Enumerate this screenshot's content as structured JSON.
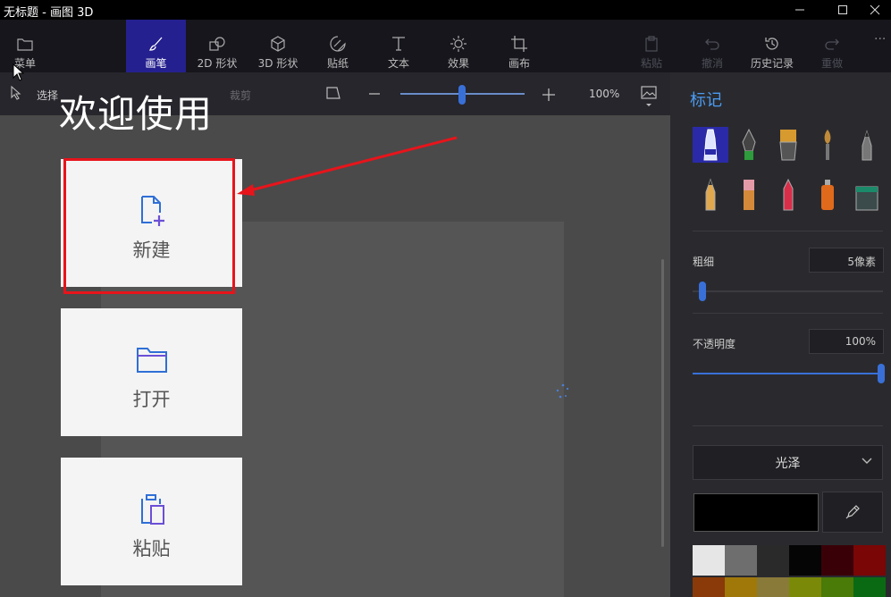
{
  "window": {
    "title": "无标题 - 画图 3D"
  },
  "toolbar": {
    "menu": "菜单",
    "items": [
      {
        "key": "brushes",
        "label": "画笔",
        "icon": "brush-icon",
        "active": true
      },
      {
        "key": "shapes2d",
        "label": "2D 形状",
        "icon": "shapes-2d-icon"
      },
      {
        "key": "shapes3d",
        "label": "3D 形状",
        "icon": "cube-icon"
      },
      {
        "key": "stickers",
        "label": "贴纸",
        "icon": "sticker-icon"
      },
      {
        "key": "text",
        "label": "文本",
        "icon": "text-icon"
      },
      {
        "key": "effects",
        "label": "效果",
        "icon": "sun-icon"
      },
      {
        "key": "canvas",
        "label": "画布",
        "icon": "crop-icon"
      }
    ],
    "right_items": [
      {
        "key": "paste",
        "label": "粘贴",
        "icon": "paste-icon",
        "disabled": true
      },
      {
        "key": "undo",
        "label": "撤消",
        "icon": "undo-icon",
        "disabled": true
      },
      {
        "key": "history",
        "label": "历史记录",
        "icon": "history-icon"
      },
      {
        "key": "redo",
        "label": "重做",
        "icon": "redo-icon",
        "disabled": true
      }
    ]
  },
  "subbar": {
    "select": "选择",
    "crop": "裁剪",
    "zoom": "100%"
  },
  "welcome": {
    "title": "欢迎使用",
    "cards": [
      {
        "key": "new",
        "label": "新建",
        "icon": "new-file-icon"
      },
      {
        "key": "open",
        "label": "打开",
        "icon": "folder-icon"
      },
      {
        "key": "paste",
        "label": "粘贴",
        "icon": "clipboard-icon"
      }
    ]
  },
  "panel": {
    "title": "标记",
    "thickness_label": "粗细",
    "thickness_value": "5像素",
    "opacity_label": "不透明度",
    "opacity_value": "100%",
    "finish": "光泽",
    "palette": [
      "#e6e6e6",
      "#6e6e6e",
      "#2a2a2a",
      "#050505",
      "#3a0008",
      "#7a0606",
      "#8a3a08",
      "#a0780a",
      "#8a7a3a",
      "#7a8a08",
      "#4a7a08",
      "#0a6a14"
    ]
  }
}
